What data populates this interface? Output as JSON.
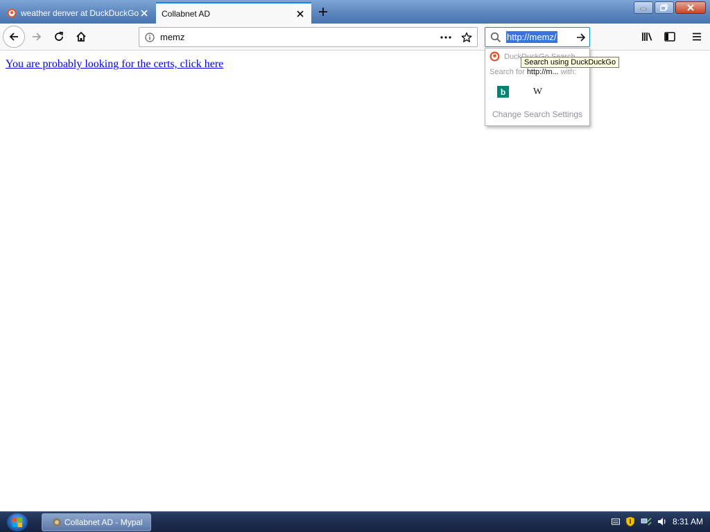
{
  "window": {
    "tabs": [
      {
        "label": "weather denver at DuckDuckGo",
        "active": false
      },
      {
        "label": "Collabnet AD",
        "active": true
      }
    ]
  },
  "navbar": {
    "url": "memz",
    "search_text": "http://memz/"
  },
  "page": {
    "link_text": "You are probably looking for the certs, click here"
  },
  "search_popup": {
    "engine_label": "DuckDuckGo Search",
    "search_for_prefix": "Search for",
    "search_for_term": "http://m...",
    "search_for_suffix": "with:",
    "engines": [
      "bing-icon",
      "wikipedia-icon"
    ],
    "settings_label": "Change Search Settings",
    "tooltip": "Search using DuckDuckGo"
  },
  "taskbar": {
    "task_label": "Collabnet AD - Mypal",
    "clock": "8:31 AM"
  },
  "colors": {
    "accent": "#0a84ff",
    "link": "#0000ee",
    "selection": "#3875d7",
    "taskbar": "#1c2d4f"
  }
}
